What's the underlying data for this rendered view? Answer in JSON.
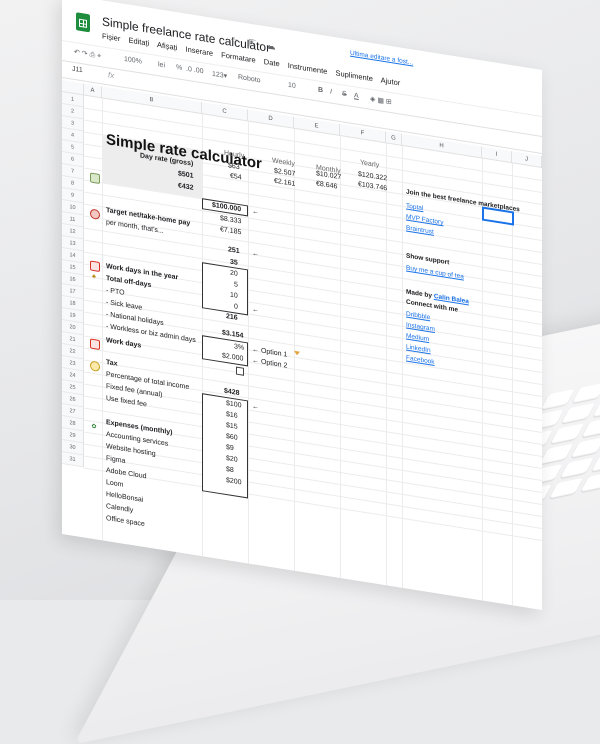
{
  "window": {
    "doc_title": "Simple freelance rate calculator",
    "last_edit": "Ultima editare a fost...",
    "menu": [
      "Fișier",
      "Editați",
      "Afișați",
      "Inserare",
      "Formatare",
      "Date",
      "Instrumente",
      "Suplimente",
      "Ajutor"
    ]
  },
  "toolbar": {
    "zoom": "100%",
    "currency": "lei",
    "percent": "%",
    "decimals": ".0 .00",
    "numfmt": "123▾",
    "font": "Roboto",
    "size": "10",
    "bold": "B",
    "italic": "I",
    "strike": "S",
    "color": "A"
  },
  "formula_bar": {
    "cell_ref": "J11",
    "fx": "fx"
  },
  "columns": [
    "A",
    "B",
    "C",
    "D",
    "E",
    "F",
    "G",
    "H",
    "I",
    "J"
  ],
  "rows": [
    "1",
    "2",
    "3",
    "4",
    "5",
    "6",
    "7",
    "8",
    "9",
    "10",
    "11",
    "12",
    "13",
    "14",
    "15",
    "16",
    "17",
    "18",
    "19",
    "20",
    "21",
    "22",
    "23",
    "24",
    "25",
    "26",
    "27",
    "28",
    "29",
    "30",
    "31"
  ],
  "sheet": {
    "title": "Simple rate calculator",
    "rate_headers": [
      "Hourly",
      "Weekly",
      "Monthly",
      "Yearly"
    ],
    "day_rate_label": "Day rate (gross)",
    "day_rate_gross": "$501",
    "day_rate_eur": "€432",
    "hourly": [
      "$63",
      "€54"
    ],
    "weekly": [
      "$2.507",
      "€2.161"
    ],
    "monthly": [
      "$10.027",
      "€8.646"
    ],
    "yearly": [
      "$120.322",
      "€103.746"
    ],
    "target_label": "Target net/take-home pay",
    "target_value": "$100.000",
    "per_month_label": "per month, that's...",
    "per_month_usd": "$8.333",
    "per_month_eur": "€7.185",
    "work_days_year_label": "Work days in the year",
    "work_days_year": "251",
    "off_days_label": "Total off-days",
    "off_days": "35",
    "pto_label": "- PTO",
    "pto": "20",
    "sick_label": "- Sick leave",
    "sick": "5",
    "national_label": "- National holidays",
    "national": "10",
    "workless_label": "- Workless  or biz admin days",
    "workless": "0",
    "work_days_label": "Work days",
    "work_days": "216",
    "tax_total": "$3.154",
    "tax_label": "Tax",
    "tax_pct_label": "Percentage of total income",
    "tax_pct": "3%",
    "fixed_fee_label": "Fixed fee (annual)",
    "fixed_fee": "$2.000",
    "use_fixed_label": "Use fixed fee",
    "option1": "← Option 1",
    "option2": "← Option 2",
    "arrow": "←",
    "expenses_total": "$428",
    "expenses_label": "Expenses (monthly)",
    "expenses": [
      {
        "name": "Accounting services",
        "value": "$100"
      },
      {
        "name": "Website hosting",
        "value": "$16"
      },
      {
        "name": "Figma",
        "value": "$15"
      },
      {
        "name": "Adobe Cloud",
        "value": "$60"
      },
      {
        "name": "Loom",
        "value": "$9"
      },
      {
        "name": "HelloBonsai",
        "value": "$20"
      },
      {
        "name": "Calendly",
        "value": "$8"
      },
      {
        "name": "Office space",
        "value": "$200"
      }
    ]
  },
  "side": {
    "marketplaces_title": "Join the best freelance marketplaces",
    "marketplaces": [
      "Toptal",
      "MVP Factory",
      "Braintrust"
    ],
    "support_title": "Show support",
    "support_link": "Buy me a cup of tea",
    "made_by": "Made by",
    "author": "Calin Balea",
    "connect": "Connect with me",
    "social": [
      "Dribbble",
      "Instagram",
      "Medium",
      "LinkedIn",
      "Facebook"
    ]
  }
}
